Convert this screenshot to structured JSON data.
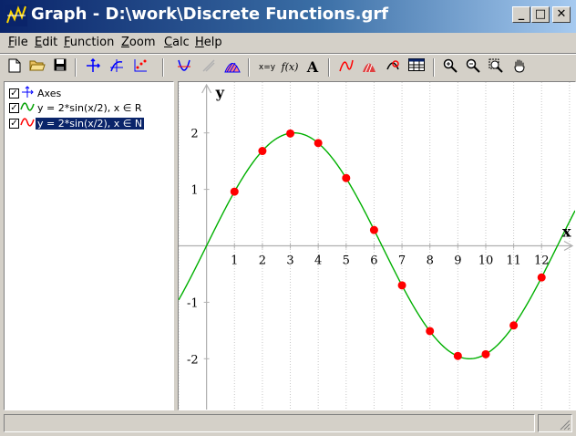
{
  "window": {
    "title": "Graph - D:\\work\\Discrete Functions.grf"
  },
  "caption_buttons": {
    "minimize": "_",
    "maximize": "□",
    "close": "✕"
  },
  "menu": [
    {
      "u": "F",
      "rest": "ile"
    },
    {
      "u": "E",
      "rest": "dit"
    },
    {
      "u": "F",
      "rest": "unction"
    },
    {
      "u": "Z",
      "rest": "oom"
    },
    {
      "u": "C",
      "rest": "alc"
    },
    {
      "u": "H",
      "rest": "elp"
    }
  ],
  "toolbar": {
    "xy_label": "x=y",
    "fx_label": "f(x)",
    "text_label": "A"
  },
  "tree": {
    "items": [
      {
        "label": "Axes",
        "checked": true,
        "color": "#0000ff",
        "selected": false
      },
      {
        "label": "y = 2*sin(x/2),  x ∈ R",
        "checked": true,
        "color": "#00a000",
        "selected": false
      },
      {
        "label": "y = 2*sin(x/2),  x ∈ N",
        "checked": true,
        "color": "#ff0000",
        "selected": true
      }
    ]
  },
  "colors": {
    "curve": "#00b000",
    "points": "#ff0000",
    "axes": "#b0b0b0",
    "grid": "#c8c8c8"
  },
  "chart_data": {
    "type": "line",
    "series": [
      {
        "kind": "function",
        "expression": "y = 2*sin(x/2)",
        "domain": "R",
        "x_range": [
          -1.0,
          13.2
        ]
      },
      {
        "kind": "points",
        "expression": "y = 2*sin(x/2)",
        "domain": "N",
        "x": [
          1,
          2,
          3,
          4,
          5,
          6,
          7,
          8,
          9,
          10,
          11,
          12
        ],
        "y": [
          0.96,
          1.68,
          1.99,
          1.82,
          1.2,
          0.28,
          -0.7,
          -1.51,
          -1.95,
          -1.92,
          -1.41,
          -0.56
        ]
      }
    ],
    "xlabel": "x",
    "ylabel": "y",
    "xlim": [
      -1.0,
      13.2
    ],
    "ylim": [
      -2.9,
      2.9
    ],
    "x_ticks": [
      "1",
      "2",
      "3",
      "4",
      "5",
      "6",
      "7",
      "8",
      "9",
      "10",
      "11",
      "12"
    ],
    "y_ticks": [
      "-2",
      "-1",
      "1",
      "2"
    ],
    "grid": "vertical dotted"
  }
}
